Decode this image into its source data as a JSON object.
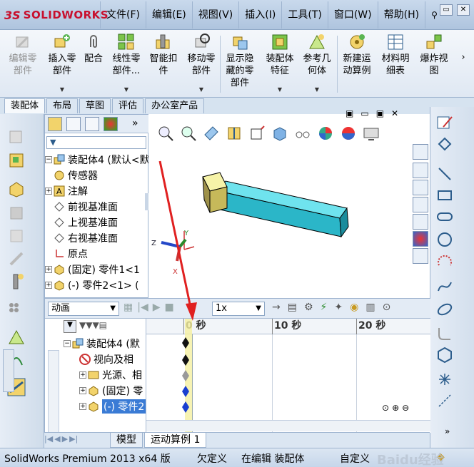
{
  "app": {
    "logo_text": "SOLIDWORKS"
  },
  "menu": [
    "文件(F)",
    "编辑(E)",
    "视图(V)",
    "插入(I)",
    "工具(T)",
    "窗口(W)",
    "帮助(H)"
  ],
  "command_manager": {
    "edit_component": "编辑零\n部件",
    "insert_components": "插入零\n部件",
    "mate": "配合",
    "linear_pattern": "线性零\n部件...",
    "smart_fasteners": "智能扣\n件",
    "move_component": "移动零\n部件",
    "show_hidden": "显示隐\n藏的零\n部件",
    "assembly_features": "装配体\n特征",
    "reference_geometry": "参考几\n何体",
    "new_motion_study": "新建运\n动算例",
    "bill_of_materials": "材料明\n细表",
    "exploded_view": "爆炸视\n图"
  },
  "tabs": [
    "装配体",
    "布局",
    "草图",
    "评估",
    "办公室产品"
  ],
  "tree": {
    "root": "装配体4 (默认<默",
    "sensors": "传感器",
    "annotations": "注解",
    "front_plane": "前视基准面",
    "top_plane": "上视基准面",
    "right_plane": "右视基准面",
    "origin": "原点",
    "part1": "(固定) 零件1<1",
    "part2": "(-) 零件2<1> ("
  },
  "motion": {
    "study_type": "动画",
    "speed": "1x",
    "ruler": [
      "0 秒",
      "10 秒",
      "20 秒"
    ],
    "tree": {
      "root": "装配体4 (默",
      "view": "视向及相",
      "lights": "光源、相",
      "part1": "(固定) 零",
      "part2": "(-) 零件2"
    }
  },
  "bottom_tabs": [
    "模型",
    "运动算例 1"
  ],
  "status": {
    "product": "SolidWorks Premium 2013 x64 版",
    "state": "欠定义",
    "editing": "在编辑 装配体",
    "custom": "自定义"
  },
  "watermark": "Baidu经验",
  "axis": {
    "x": "X",
    "y": "Y",
    "z": "Z"
  },
  "colors": {
    "accent_red": "#c8102e",
    "bar_cyan": "#3ad0e0",
    "block_yellow": "#f2ee9a",
    "arrow_red": "#e02020",
    "key_blue": "#1a3fd0"
  }
}
